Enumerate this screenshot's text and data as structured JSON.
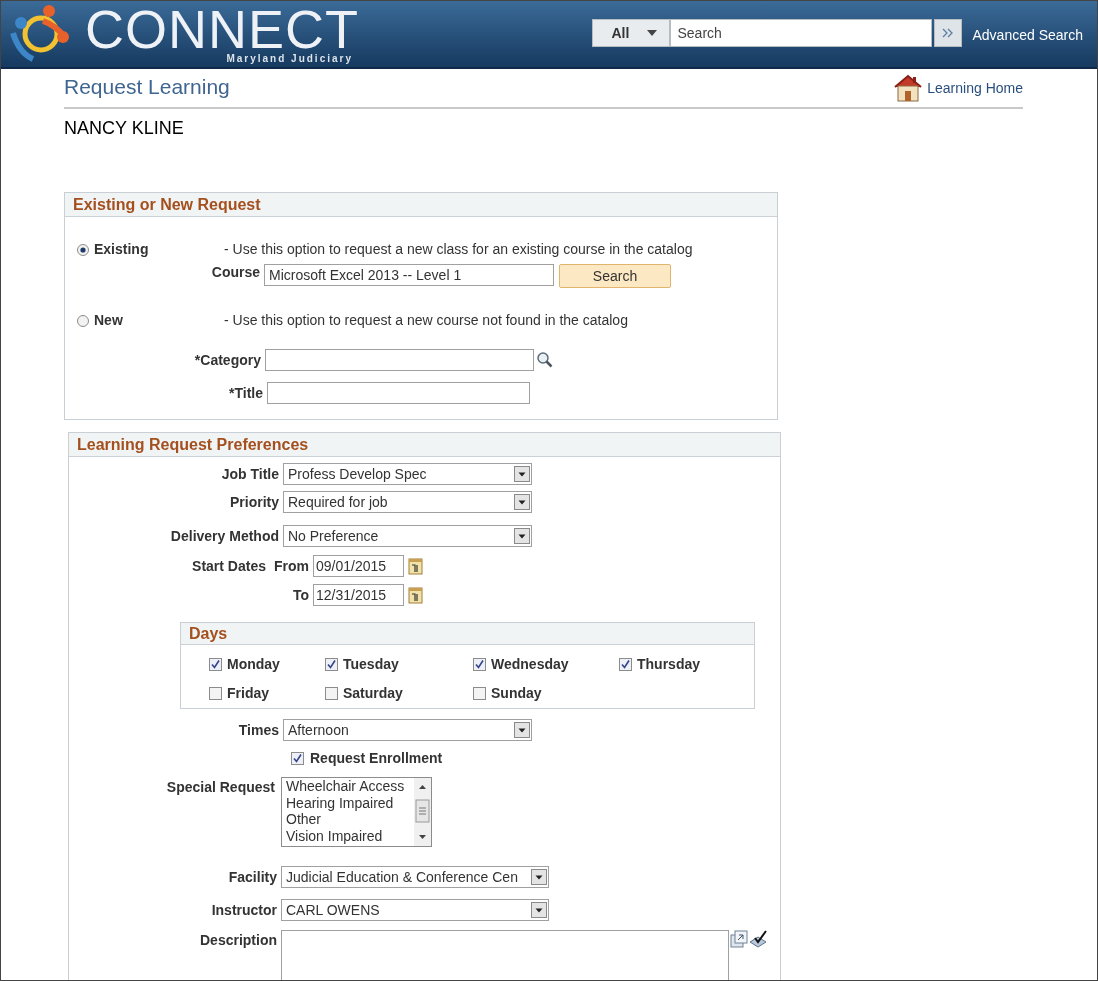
{
  "header": {
    "logo_title": "CONNECT",
    "logo_subtitle": "Maryland Judiciary",
    "search_scope": "All",
    "search_placeholder": "Search",
    "advanced_link": "Advanced Search"
  },
  "page": {
    "title": "Request Learning",
    "home_link": "Learning Home",
    "user_name": "NANCY KLINE"
  },
  "request_section": {
    "title": "Existing or New Request",
    "options": [
      {
        "label": "Existing",
        "description": "- Use this option to request a new class for an existing course in the catalog",
        "selected": true,
        "fields": [
          {
            "kind": "course",
            "label": "Course",
            "value": "Microsoft Excel 2013 -- Level 1",
            "button": "Search"
          }
        ]
      },
      {
        "label": "New",
        "description": "- Use this option to request a new course not found in the catalog",
        "selected": false,
        "fields": [
          {
            "kind": "lookup",
            "label": "*Category"
          },
          {
            "kind": "text",
            "label": "*Title"
          }
        ]
      }
    ]
  },
  "preferences": {
    "title": "Learning Request Preferences",
    "top_fields": [
      {
        "kind": "select",
        "label": "Job Title",
        "value": "Profess Develop Spec"
      },
      {
        "kind": "select",
        "label": "Priority",
        "value": "Required for job"
      },
      {
        "kind": "select",
        "label": "Delivery Method",
        "value": "No Preference"
      }
    ],
    "start_dates": {
      "label": "Start Dates",
      "from_label": "From",
      "from": "09/01/2015",
      "to_label": "To",
      "to": "12/31/2015"
    },
    "days": {
      "title": "Days",
      "items": [
        {
          "label": "Monday",
          "checked": true
        },
        {
          "label": "Tuesday",
          "checked": true
        },
        {
          "label": "Wednesday",
          "checked": true
        },
        {
          "label": "Thursday",
          "checked": true
        },
        {
          "label": "Friday",
          "checked": false
        },
        {
          "label": "Saturday",
          "checked": false
        },
        {
          "label": "Sunday",
          "checked": false
        }
      ]
    },
    "times": {
      "label": "Times",
      "value": "Afternoon"
    },
    "request_enrollment": {
      "label": "Request Enrollment",
      "checked": true
    },
    "special_request": {
      "label": "Special Request",
      "options": [
        "Wheelchair Access",
        "Hearing Impaired",
        "Other",
        "Vision Impaired"
      ]
    },
    "bottom_fields": [
      {
        "kind": "select",
        "label": "Facility",
        "value": "Judicial Education & Conference Cen"
      },
      {
        "kind": "select",
        "label": "Instructor",
        "value": "CARL OWENS"
      }
    ],
    "description": {
      "label": "Description"
    }
  }
}
